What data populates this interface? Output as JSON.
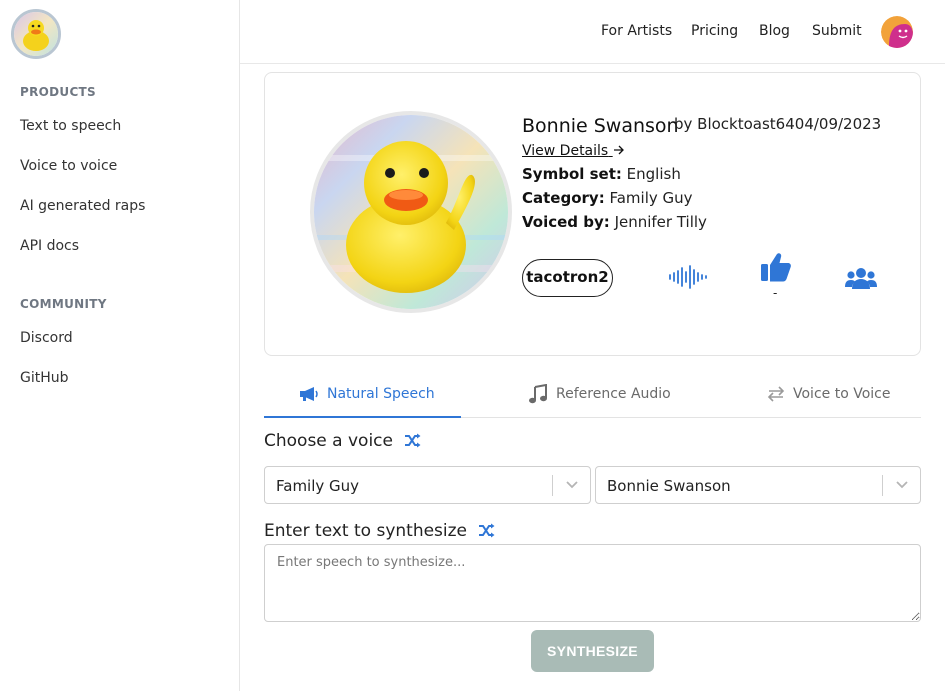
{
  "sidebar": {
    "logo_alt": "duck-logo",
    "products_heading": "PRODUCTS",
    "products": [
      {
        "label": "Text to speech"
      },
      {
        "label": "Voice to voice"
      },
      {
        "label": "AI generated raps"
      },
      {
        "label": "API docs"
      }
    ],
    "community_heading": "COMMUNITY",
    "community": [
      {
        "label": "Discord"
      },
      {
        "label": "GitHub"
      }
    ]
  },
  "header": {
    "nav": [
      {
        "label": "For Artists"
      },
      {
        "label": "Pricing"
      },
      {
        "label": "Blog"
      },
      {
        "label": "Submit"
      }
    ]
  },
  "voice": {
    "name": "Bonnie Swanson",
    "by_text": "by Blocktoast6404/09/2023",
    "view_details": "View Details",
    "symbol_label": "Symbol set:",
    "symbol_value": "English",
    "category_label": "Category:",
    "category_value": "Family Guy",
    "voiced_label": "Voiced by:",
    "voiced_value": "Jennifer Tilly",
    "model": "tacotron2",
    "like_count": "-"
  },
  "tabs": [
    {
      "label": "Natural Speech",
      "icon": "megaphone-icon",
      "active": true
    },
    {
      "label": "Reference Audio",
      "icon": "music-note-icon",
      "active": false
    },
    {
      "label": "Voice to Voice",
      "icon": "swap-arrows-icon",
      "active": false
    }
  ],
  "form": {
    "choose_label": "Choose a voice",
    "category_select": "Family Guy",
    "voice_select": "Bonnie Swanson",
    "text_label": "Enter text to synthesize",
    "text_placeholder": "Enter speech to synthesize...",
    "synth_button": "SYNTHESIZE"
  },
  "colors": {
    "accent": "#2f76d6",
    "button_disabled": "#a9bbb6",
    "border": "#e3e3e3"
  }
}
